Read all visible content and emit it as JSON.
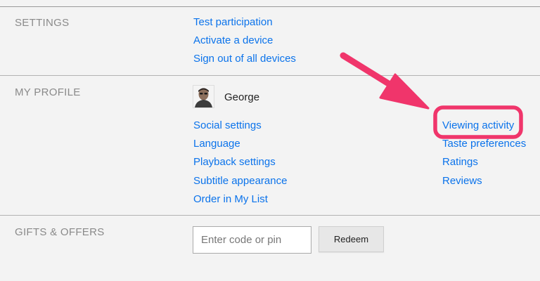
{
  "settings": {
    "label": "SETTINGS",
    "links": [
      "Test participation",
      "Activate a device",
      "Sign out of all devices"
    ]
  },
  "profile": {
    "label": "MY PROFILE",
    "name": "George",
    "left_links": [
      "Social settings",
      "Language",
      "Playback settings",
      "Subtitle appearance",
      "Order in My List"
    ],
    "right_links": [
      "Viewing activity",
      "Taste preferences",
      "Ratings",
      "Reviews"
    ]
  },
  "gifts": {
    "label": "GIFTS & OFFERS",
    "placeholder": "Enter code or pin",
    "button_label": "Redeem"
  },
  "annotation": {
    "color": "#f0356b"
  }
}
